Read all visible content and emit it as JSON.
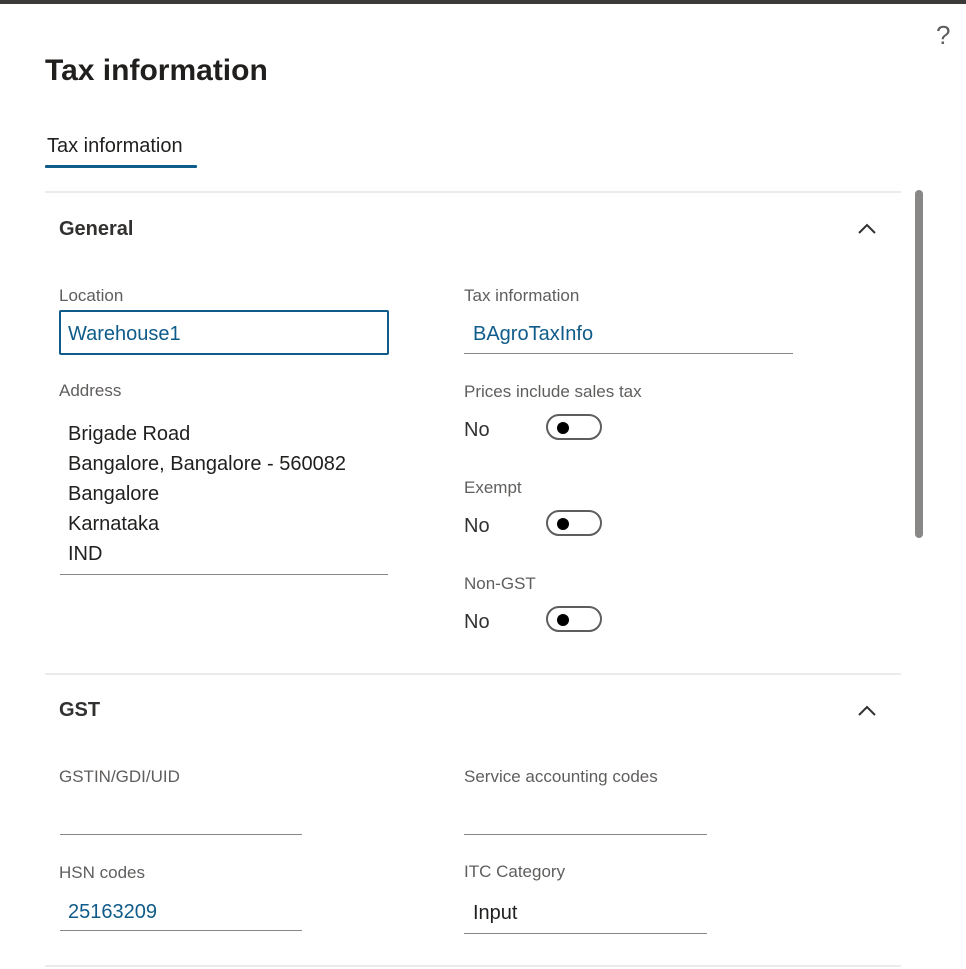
{
  "header": {
    "title": "Tax information",
    "help_glyph": "?"
  },
  "tabs": [
    {
      "label": "Tax information",
      "selected": true
    }
  ],
  "general": {
    "title": "General",
    "location": {
      "label": "Location",
      "value": "Warehouse1"
    },
    "address": {
      "label": "Address",
      "lines": [
        "Brigade Road",
        "Bangalore, Bangalore - 560082",
        "Bangalore",
        "Karnataka",
        "IND"
      ]
    },
    "tax_information": {
      "label": "Tax information",
      "value": "BAgroTaxInfo"
    },
    "prices_include_sales_tax": {
      "label": "Prices include sales tax",
      "value": "No"
    },
    "exempt": {
      "label": "Exempt",
      "value": "No"
    },
    "non_gst": {
      "label": "Non-GST",
      "value": "No"
    }
  },
  "gst": {
    "title": "GST",
    "gstin": {
      "label": "GSTIN/GDI/UID",
      "value": ""
    },
    "service_accounting_codes": {
      "label": "Service accounting codes",
      "value": ""
    },
    "hsn_codes": {
      "label": "HSN codes",
      "value": "25163209"
    },
    "itc_category": {
      "label": "ITC Category",
      "value": "Input"
    }
  },
  "icons": {
    "help": "help-icon",
    "collapse": "chevron-up-icon",
    "toggle_knob": "toggle-knob"
  },
  "colors": {
    "accent": "#0f5b8a",
    "text": "#201f1e",
    "label": "#605e5c",
    "divider": "#edebe9",
    "topbar": "#3b3a39"
  }
}
